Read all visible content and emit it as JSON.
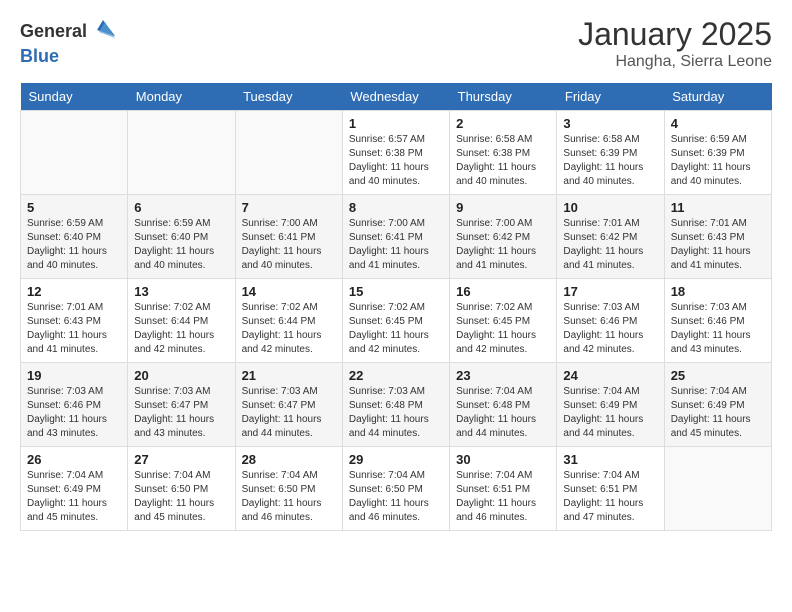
{
  "header": {
    "logo_general": "General",
    "logo_blue": "Blue",
    "month_title": "January 2025",
    "subtitle": "Hangha, Sierra Leone"
  },
  "weekdays": [
    "Sunday",
    "Monday",
    "Tuesday",
    "Wednesday",
    "Thursday",
    "Friday",
    "Saturday"
  ],
  "weeks": [
    [
      {
        "day": "",
        "sunrise": "",
        "sunset": "",
        "daylight": ""
      },
      {
        "day": "",
        "sunrise": "",
        "sunset": "",
        "daylight": ""
      },
      {
        "day": "",
        "sunrise": "",
        "sunset": "",
        "daylight": ""
      },
      {
        "day": "1",
        "sunrise": "Sunrise: 6:57 AM",
        "sunset": "Sunset: 6:38 PM",
        "daylight": "Daylight: 11 hours and 40 minutes."
      },
      {
        "day": "2",
        "sunrise": "Sunrise: 6:58 AM",
        "sunset": "Sunset: 6:38 PM",
        "daylight": "Daylight: 11 hours and 40 minutes."
      },
      {
        "day": "3",
        "sunrise": "Sunrise: 6:58 AM",
        "sunset": "Sunset: 6:39 PM",
        "daylight": "Daylight: 11 hours and 40 minutes."
      },
      {
        "day": "4",
        "sunrise": "Sunrise: 6:59 AM",
        "sunset": "Sunset: 6:39 PM",
        "daylight": "Daylight: 11 hours and 40 minutes."
      }
    ],
    [
      {
        "day": "5",
        "sunrise": "Sunrise: 6:59 AM",
        "sunset": "Sunset: 6:40 PM",
        "daylight": "Daylight: 11 hours and 40 minutes."
      },
      {
        "day": "6",
        "sunrise": "Sunrise: 6:59 AM",
        "sunset": "Sunset: 6:40 PM",
        "daylight": "Daylight: 11 hours and 40 minutes."
      },
      {
        "day": "7",
        "sunrise": "Sunrise: 7:00 AM",
        "sunset": "Sunset: 6:41 PM",
        "daylight": "Daylight: 11 hours and 40 minutes."
      },
      {
        "day": "8",
        "sunrise": "Sunrise: 7:00 AM",
        "sunset": "Sunset: 6:41 PM",
        "daylight": "Daylight: 11 hours and 41 minutes."
      },
      {
        "day": "9",
        "sunrise": "Sunrise: 7:00 AM",
        "sunset": "Sunset: 6:42 PM",
        "daylight": "Daylight: 11 hours and 41 minutes."
      },
      {
        "day": "10",
        "sunrise": "Sunrise: 7:01 AM",
        "sunset": "Sunset: 6:42 PM",
        "daylight": "Daylight: 11 hours and 41 minutes."
      },
      {
        "day": "11",
        "sunrise": "Sunrise: 7:01 AM",
        "sunset": "Sunset: 6:43 PM",
        "daylight": "Daylight: 11 hours and 41 minutes."
      }
    ],
    [
      {
        "day": "12",
        "sunrise": "Sunrise: 7:01 AM",
        "sunset": "Sunset: 6:43 PM",
        "daylight": "Daylight: 11 hours and 41 minutes."
      },
      {
        "day": "13",
        "sunrise": "Sunrise: 7:02 AM",
        "sunset": "Sunset: 6:44 PM",
        "daylight": "Daylight: 11 hours and 42 minutes."
      },
      {
        "day": "14",
        "sunrise": "Sunrise: 7:02 AM",
        "sunset": "Sunset: 6:44 PM",
        "daylight": "Daylight: 11 hours and 42 minutes."
      },
      {
        "day": "15",
        "sunrise": "Sunrise: 7:02 AM",
        "sunset": "Sunset: 6:45 PM",
        "daylight": "Daylight: 11 hours and 42 minutes."
      },
      {
        "day": "16",
        "sunrise": "Sunrise: 7:02 AM",
        "sunset": "Sunset: 6:45 PM",
        "daylight": "Daylight: 11 hours and 42 minutes."
      },
      {
        "day": "17",
        "sunrise": "Sunrise: 7:03 AM",
        "sunset": "Sunset: 6:46 PM",
        "daylight": "Daylight: 11 hours and 42 minutes."
      },
      {
        "day": "18",
        "sunrise": "Sunrise: 7:03 AM",
        "sunset": "Sunset: 6:46 PM",
        "daylight": "Daylight: 11 hours and 43 minutes."
      }
    ],
    [
      {
        "day": "19",
        "sunrise": "Sunrise: 7:03 AM",
        "sunset": "Sunset: 6:46 PM",
        "daylight": "Daylight: 11 hours and 43 minutes."
      },
      {
        "day": "20",
        "sunrise": "Sunrise: 7:03 AM",
        "sunset": "Sunset: 6:47 PM",
        "daylight": "Daylight: 11 hours and 43 minutes."
      },
      {
        "day": "21",
        "sunrise": "Sunrise: 7:03 AM",
        "sunset": "Sunset: 6:47 PM",
        "daylight": "Daylight: 11 hours and 44 minutes."
      },
      {
        "day": "22",
        "sunrise": "Sunrise: 7:03 AM",
        "sunset": "Sunset: 6:48 PM",
        "daylight": "Daylight: 11 hours and 44 minutes."
      },
      {
        "day": "23",
        "sunrise": "Sunrise: 7:04 AM",
        "sunset": "Sunset: 6:48 PM",
        "daylight": "Daylight: 11 hours and 44 minutes."
      },
      {
        "day": "24",
        "sunrise": "Sunrise: 7:04 AM",
        "sunset": "Sunset: 6:49 PM",
        "daylight": "Daylight: 11 hours and 44 minutes."
      },
      {
        "day": "25",
        "sunrise": "Sunrise: 7:04 AM",
        "sunset": "Sunset: 6:49 PM",
        "daylight": "Daylight: 11 hours and 45 minutes."
      }
    ],
    [
      {
        "day": "26",
        "sunrise": "Sunrise: 7:04 AM",
        "sunset": "Sunset: 6:49 PM",
        "daylight": "Daylight: 11 hours and 45 minutes."
      },
      {
        "day": "27",
        "sunrise": "Sunrise: 7:04 AM",
        "sunset": "Sunset: 6:50 PM",
        "daylight": "Daylight: 11 hours and 45 minutes."
      },
      {
        "day": "28",
        "sunrise": "Sunrise: 7:04 AM",
        "sunset": "Sunset: 6:50 PM",
        "daylight": "Daylight: 11 hours and 46 minutes."
      },
      {
        "day": "29",
        "sunrise": "Sunrise: 7:04 AM",
        "sunset": "Sunset: 6:50 PM",
        "daylight": "Daylight: 11 hours and 46 minutes."
      },
      {
        "day": "30",
        "sunrise": "Sunrise: 7:04 AM",
        "sunset": "Sunset: 6:51 PM",
        "daylight": "Daylight: 11 hours and 46 minutes."
      },
      {
        "day": "31",
        "sunrise": "Sunrise: 7:04 AM",
        "sunset": "Sunset: 6:51 PM",
        "daylight": "Daylight: 11 hours and 47 minutes."
      },
      {
        "day": "",
        "sunrise": "",
        "sunset": "",
        "daylight": ""
      }
    ]
  ]
}
